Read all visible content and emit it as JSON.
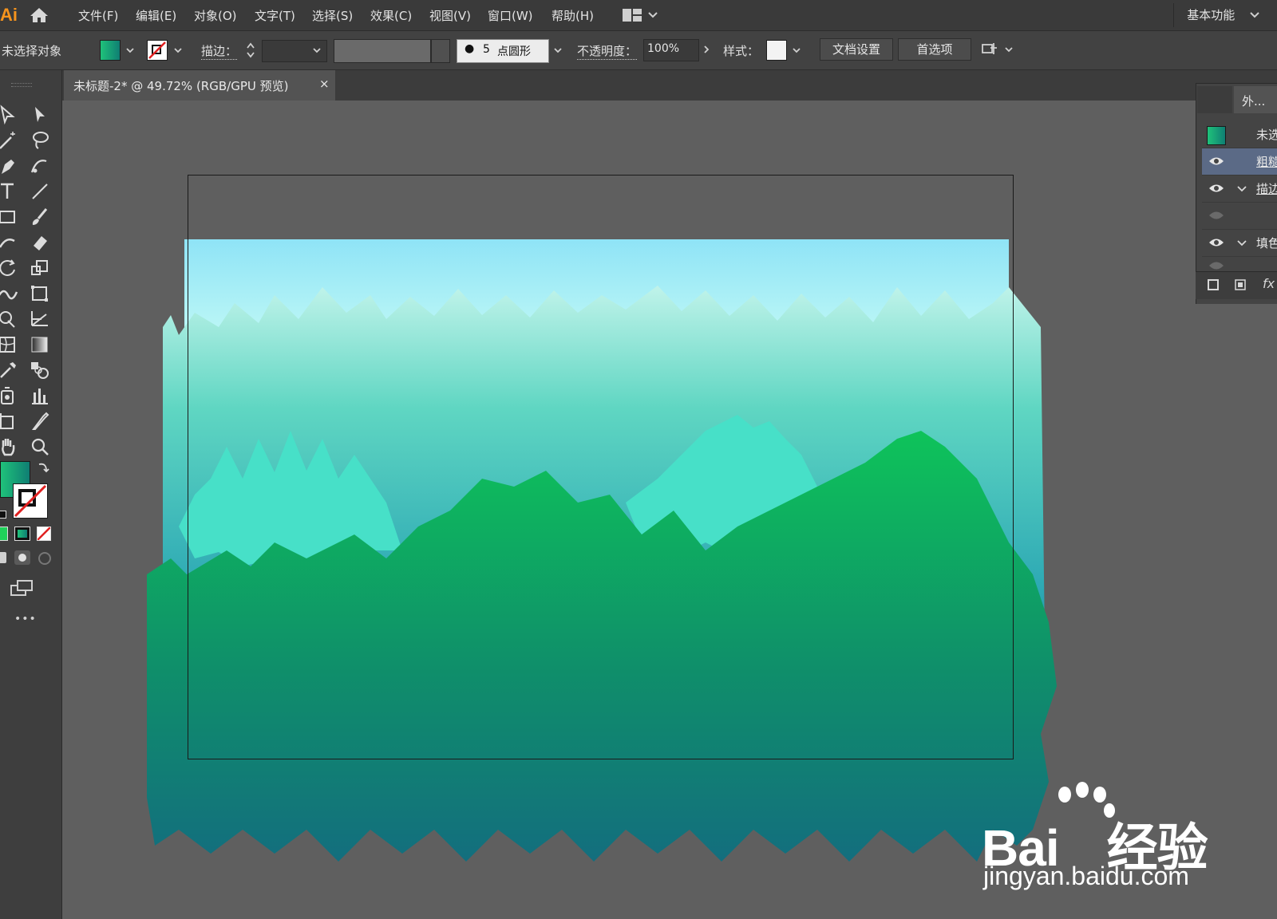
{
  "app": {
    "logo": "Ai"
  },
  "menu": {
    "items": [
      "文件(F)",
      "编辑(E)",
      "对象(O)",
      "文字(T)",
      "选择(S)",
      "效果(C)",
      "视图(V)",
      "窗口(W)",
      "帮助(H)"
    ],
    "workspace": "基本功能"
  },
  "controlbar": {
    "selection_status": "未选择对象",
    "stroke_label": "描边：",
    "brush_size": "5",
    "brush_name": "点圆形",
    "opacity_label": "不透明度：",
    "opacity_value": "100%",
    "style_label": "样式：",
    "doc_setup_button": "文档设置",
    "preferences_button": "首选项"
  },
  "document": {
    "tab_title": "未标题-2* @ 49.72% (RGB/GPU 预览)",
    "close_glyph": "×"
  },
  "appearance_panel": {
    "tab_label": "外...",
    "rows": [
      {
        "label": "未选",
        "visible": null
      },
      {
        "label": "粗糙",
        "visible": true
      },
      {
        "label": "描边",
        "visible": true
      },
      {
        "label": "",
        "visible": false
      },
      {
        "label": "填色",
        "visible": true
      },
      {
        "label": "",
        "visible": false
      }
    ],
    "fx_label": "fx"
  },
  "toolbar": {
    "more_glyph": "•••"
  },
  "colors": {
    "accent_fill_start": "#1fc27a",
    "accent_fill_end": "#0f7e73",
    "sky_top": "#6fd6f7",
    "sky_mid": "#c8fcf6",
    "grass_light": "#47e0c8",
    "grass_green": "#0ec35a",
    "grass_dark": "#136e7e"
  },
  "watermark": {
    "brand": "Bai",
    "brand_suffix": "经验",
    "url": "jingyan.baidu.com"
  }
}
